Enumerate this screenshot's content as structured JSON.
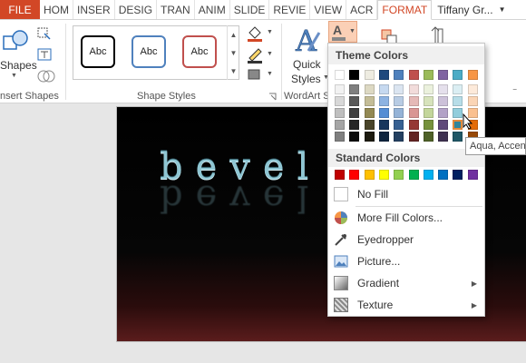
{
  "tabs": {
    "file": "FILE",
    "home": "HOM",
    "insert": "INSER",
    "design": "DESIG",
    "transitions": "TRAN",
    "animations": "ANIM",
    "slideshow": "SLIDE",
    "review": "REVIE",
    "view": "VIEW",
    "acrobat": "ACR",
    "format": "FORMAT",
    "user": "Tiffany Gr..."
  },
  "ribbon": {
    "shapes_label": "Shapes",
    "insert_shapes_group": "nsert Shapes",
    "shape_styles_group": "Shape Styles",
    "style_sample": "Abc",
    "quick_styles_label": "Quick",
    "quick_styles_label2": "Styles",
    "wordart_group": "WordArt S"
  },
  "slide": {
    "text": "bevel &"
  },
  "dropdown": {
    "theme_colors_header": "Theme Colors",
    "standard_colors_header": "Standard Colors",
    "no_fill": "No Fill",
    "more_fill_colors": "More Fill Colors...",
    "eyedropper": "Eyedropper",
    "picture": "Picture...",
    "gradient": "Gradient",
    "texture": "Texture"
  },
  "theme_colors": [
    [
      "#ffffff",
      "#000000",
      "#eeece1",
      "#1f497d",
      "#4f81bd",
      "#c0504d",
      "#9bbb59",
      "#8064a2",
      "#4bacc6",
      "#f79646"
    ],
    [
      "#f2f2f2",
      "#7f7f7f",
      "#ddd9c3",
      "#c6d9f0",
      "#dbe5f1",
      "#f2dcdb",
      "#ebf1dd",
      "#e5e0ec",
      "#dbeef3",
      "#fdeada"
    ],
    [
      "#d8d8d8",
      "#595959",
      "#c4bd97",
      "#8db3e2",
      "#b8cce4",
      "#e5b9b7",
      "#d7e3bc",
      "#ccc1d9",
      "#b7dde8",
      "#fbd5b5"
    ],
    [
      "#bfbfbf",
      "#3f3f3f",
      "#938953",
      "#548dd4",
      "#95b3d7",
      "#d99694",
      "#c3d69b",
      "#b2a2c7",
      "#92cddc",
      "#fac08f"
    ],
    [
      "#a5a5a5",
      "#262626",
      "#494429",
      "#17365d",
      "#366092",
      "#953734",
      "#76923c",
      "#5f497a",
      "#31859b",
      "#e36c09"
    ],
    [
      "#7f7f7f",
      "#0c0c0c",
      "#1d1b10",
      "#0f243e",
      "#244061",
      "#632423",
      "#4f6128",
      "#3f3151",
      "#205867",
      "#974806"
    ]
  ],
  "standard_colors": [
    "#c00000",
    "#ff0000",
    "#ffc000",
    "#ffff00",
    "#92d050",
    "#00b050",
    "#00b0f0",
    "#0070c0",
    "#002060",
    "#7030a0"
  ],
  "tooltip": "Aqua, Accen",
  "colors": {
    "file_tab": "#d24726",
    "format_tab_text": "#d24726"
  }
}
